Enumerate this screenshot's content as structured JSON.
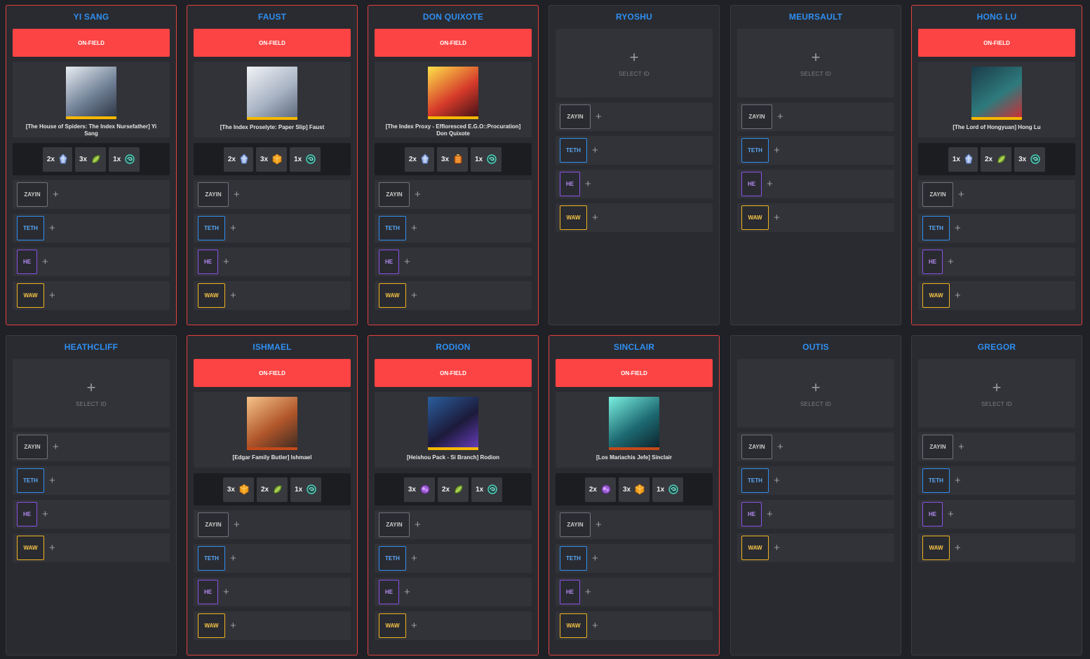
{
  "labels": {
    "on_field": "ON-FIELD",
    "select_id": "SELECT ID",
    "add": "+"
  },
  "tiers": [
    "ZAYIN",
    "TETH",
    "HE",
    "WAW"
  ],
  "colors": {
    "background": "#202126",
    "card": "#2a2b30",
    "active_border": "#e2403f",
    "on_field": "#fc4444",
    "title": "#2f8ff2",
    "zayin": "#72727a",
    "teth": "#2f8ff2",
    "he": "#8a52e8",
    "waw": "#f0b321"
  },
  "sinners": [
    {
      "name": "YI SANG",
      "on_field": true,
      "id_name": "[The House of Spiders: The Index Nursefather] Yi Sang",
      "portrait": {
        "bg": [
          "#e8edf3",
          "#6f7f95",
          "#2a3240"
        ],
        "bar": "#f5b800"
      },
      "resources": [
        {
          "count": "2x",
          "icon": "ice-crystal-icon"
        },
        {
          "count": "3x",
          "icon": "leaf-cluster-icon"
        },
        {
          "count": "1x",
          "icon": "teal-swirl-icon"
        }
      ]
    },
    {
      "name": "FAUST",
      "on_field": true,
      "id_name": "[The Index Proselyte: Paper Slip] Faust",
      "portrait": {
        "bg": [
          "#f2f4f7",
          "#a9b4c4",
          "#59657a"
        ],
        "bar": "#f5b800"
      },
      "resources": [
        {
          "count": "2x",
          "icon": "ice-crystal-icon"
        },
        {
          "count": "3x",
          "icon": "amber-cube-icon"
        },
        {
          "count": "1x",
          "icon": "teal-swirl-icon"
        }
      ]
    },
    {
      "name": "DON QUIXOTE",
      "on_field": true,
      "id_name": "[The Index Proxy - Effloresced E.G.O::Procuration] Don Quixote",
      "portrait": {
        "bg": [
          "#ffe24a",
          "#d63a2a",
          "#3a1016"
        ],
        "bar": "#f5b800"
      },
      "resources": [
        {
          "count": "2x",
          "icon": "ice-crystal-icon"
        },
        {
          "count": "3x",
          "icon": "orange-lantern-icon"
        },
        {
          "count": "1x",
          "icon": "teal-swirl-icon"
        }
      ]
    },
    {
      "name": "RYOSHU",
      "on_field": false
    },
    {
      "name": "MEURSAULT",
      "on_field": false
    },
    {
      "name": "HONG LU",
      "on_field": true,
      "id_name": "[The Lord of Hongyuan] Hong Lu",
      "portrait": {
        "bg": [
          "#1b3b4a",
          "#2e7a7c",
          "#d42a32"
        ],
        "bar": "#f5b800"
      },
      "resources": [
        {
          "count": "1x",
          "icon": "ice-crystal-icon"
        },
        {
          "count": "2x",
          "icon": "leaf-cluster-icon"
        },
        {
          "count": "3x",
          "icon": "teal-swirl-icon"
        }
      ]
    },
    {
      "name": "HEATHCLIFF",
      "on_field": false
    },
    {
      "name": "ISHMAEL",
      "on_field": true,
      "id_name": "[Edgar Family Butler] Ishmael",
      "portrait": {
        "bg": [
          "#f6c48a",
          "#b0552a",
          "#3a2a22"
        ],
        "bar": "#c44a1a"
      },
      "resources": [
        {
          "count": "3x",
          "icon": "amber-cube-icon"
        },
        {
          "count": "2x",
          "icon": "leaf-cluster-icon"
        },
        {
          "count": "1x",
          "icon": "teal-swirl-icon"
        }
      ]
    },
    {
      "name": "RODION",
      "on_field": true,
      "id_name": "[Heishou Pack - Si Branch] Rodion",
      "portrait": {
        "bg": [
          "#2a5f9e",
          "#1c1a3a",
          "#6a3ec2"
        ],
        "bar": "#f5b800"
      },
      "resources": [
        {
          "count": "3x",
          "icon": "violet-bloom-icon"
        },
        {
          "count": "2x",
          "icon": "leaf-cluster-icon"
        },
        {
          "count": "1x",
          "icon": "teal-swirl-icon"
        }
      ]
    },
    {
      "name": "SINCLAIR",
      "on_field": true,
      "id_name": "[Los Mariachis Jefe] Sinclair",
      "portrait": {
        "bg": [
          "#7af0e0",
          "#1d6a72",
          "#0c1f28"
        ],
        "bar": "#c44a1a"
      },
      "resources": [
        {
          "count": "2x",
          "icon": "violet-bloom-icon"
        },
        {
          "count": "3x",
          "icon": "amber-cube-icon"
        },
        {
          "count": "1x",
          "icon": "teal-swirl-icon"
        }
      ]
    },
    {
      "name": "OUTIS",
      "on_field": false
    },
    {
      "name": "GREGOR",
      "on_field": false
    }
  ]
}
